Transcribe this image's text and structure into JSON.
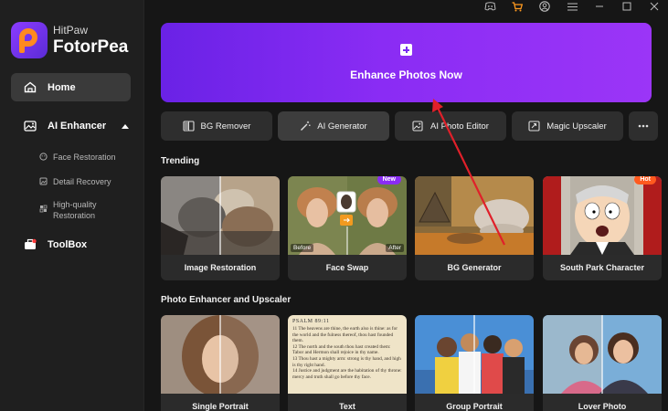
{
  "app": {
    "brand": "HitPaw",
    "name": "FotorPea"
  },
  "sidebar": {
    "home": "Home",
    "enhancer": {
      "label": "AI Enhancer",
      "items": [
        "Face Restoration",
        "Detail Recovery",
        "High-quality\nRestoration"
      ]
    },
    "toolbox": "ToolBox"
  },
  "hero": {
    "label": "Enhance Photos Now"
  },
  "tools": [
    {
      "label": "BG Remover",
      "icon": "bg-remover-icon"
    },
    {
      "label": "AI Generator",
      "icon": "magic-wand-icon"
    },
    {
      "label": "AI Photo Editor",
      "icon": "photo-edit-icon"
    },
    {
      "label": "Magic Upscaler",
      "icon": "upscale-icon"
    }
  ],
  "trending": {
    "title": "Trending",
    "cards": [
      {
        "label": "Image Restoration",
        "badge": ""
      },
      {
        "label": "Face Swap",
        "badge": "New",
        "before": "Before",
        "after": "After"
      },
      {
        "label": "BG Generator",
        "badge": ""
      },
      {
        "label": "South Park Character",
        "badge": "Hot"
      }
    ]
  },
  "enhancer_section": {
    "title": "Photo Enhancer and Upscaler",
    "cards": [
      {
        "label": "Single Portrait"
      },
      {
        "label": "Text",
        "text_header": "PSALM 89:11",
        "text_lines": [
          "11 The heavens are thine, the earth also is thine: as for the world and the fulness thereof, thou hast founded them.",
          "12 The north and the south thou hast created them: Tabor and Hermon shall rejoice in thy name.",
          "13 Thou hast a mighty arm: strong is thy hand, and high is thy right hand.",
          "14 Justice and judgment are the habitation of thy throne: mercy and truth shall go before thy face."
        ]
      },
      {
        "label": "Group Portrait"
      },
      {
        "label": "Lover Photo"
      }
    ]
  },
  "colors": {
    "accent": "#8a2cf4",
    "hot": "#ff5a1f",
    "arrow": "#e0202a"
  }
}
